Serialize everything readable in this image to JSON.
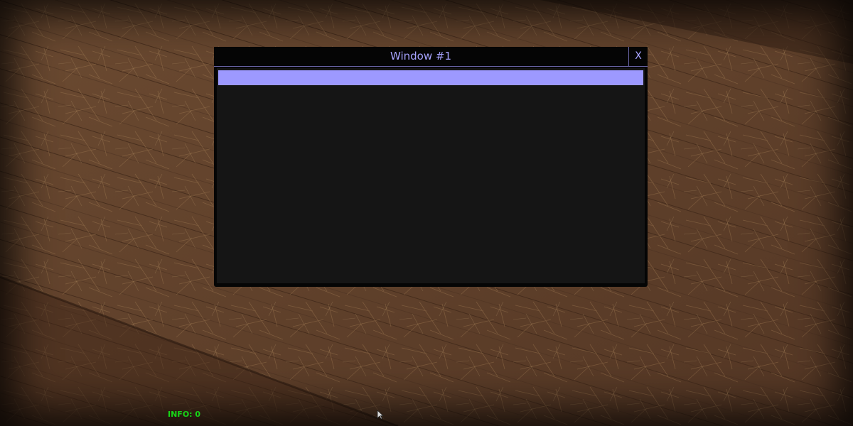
{
  "window": {
    "title": "Window #1",
    "close_label": "X",
    "list_items": [
      ""
    ]
  },
  "hud": {
    "info_text": "INFO: 0"
  },
  "colors": {
    "accent": "#a7a3ff",
    "selection": "#9d99ff",
    "window_bg": "#050505",
    "content_bg": "#151515",
    "info_text": "#17d417"
  },
  "icons": {
    "cursor": "mouse-cursor-icon"
  }
}
